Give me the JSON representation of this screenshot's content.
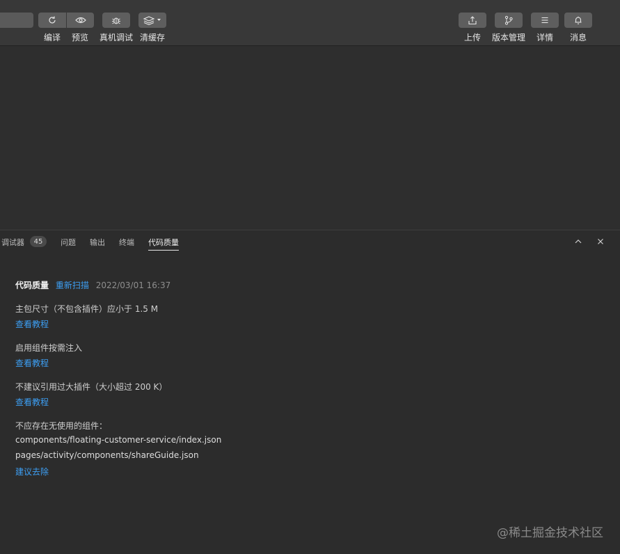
{
  "toolbar": {
    "buttons": [
      {
        "label": "编译",
        "icon": "refresh-icon"
      },
      {
        "label": "预览",
        "icon": "eye-icon"
      },
      {
        "label": "真机调试",
        "icon": "bug-icon"
      },
      {
        "label": "清缓存",
        "icon": "layers-icon"
      },
      {
        "label": "上传",
        "icon": "upload-icon"
      },
      {
        "label": "版本管理",
        "icon": "branch-icon"
      },
      {
        "label": "详情",
        "icon": "menu-icon"
      },
      {
        "label": "消息",
        "icon": "bell-icon"
      }
    ]
  },
  "panel": {
    "tabs": [
      {
        "label": "调试器",
        "badge": "45"
      },
      {
        "label": "问题"
      },
      {
        "label": "输出"
      },
      {
        "label": "终端"
      },
      {
        "label": "代码质量"
      }
    ],
    "active_tab": "代码质量"
  },
  "quality": {
    "title": "代码质量",
    "rescan_label": "重新扫描",
    "timestamp": "2022/03/01 16:37",
    "items": [
      {
        "text": "主包尺寸（不包含插件）应小于 1.5 M",
        "link": "查看教程"
      },
      {
        "text": "启用组件按需注入",
        "link": "查看教程"
      },
      {
        "text": "不建议引用过大插件（大小超过 200 K）",
        "link": "查看教程"
      }
    ],
    "unused": {
      "text": "不应存在无使用的组件：",
      "files": [
        "components/floating-customer-service/index.json",
        "pages/activity/components/shareGuide.json"
      ],
      "link": "建议去除"
    }
  },
  "watermark": "@稀土掘金技术社区",
  "colors": {
    "link": "#3d9ff4",
    "background": "#2c2c2c",
    "toolbar": "#383838"
  }
}
